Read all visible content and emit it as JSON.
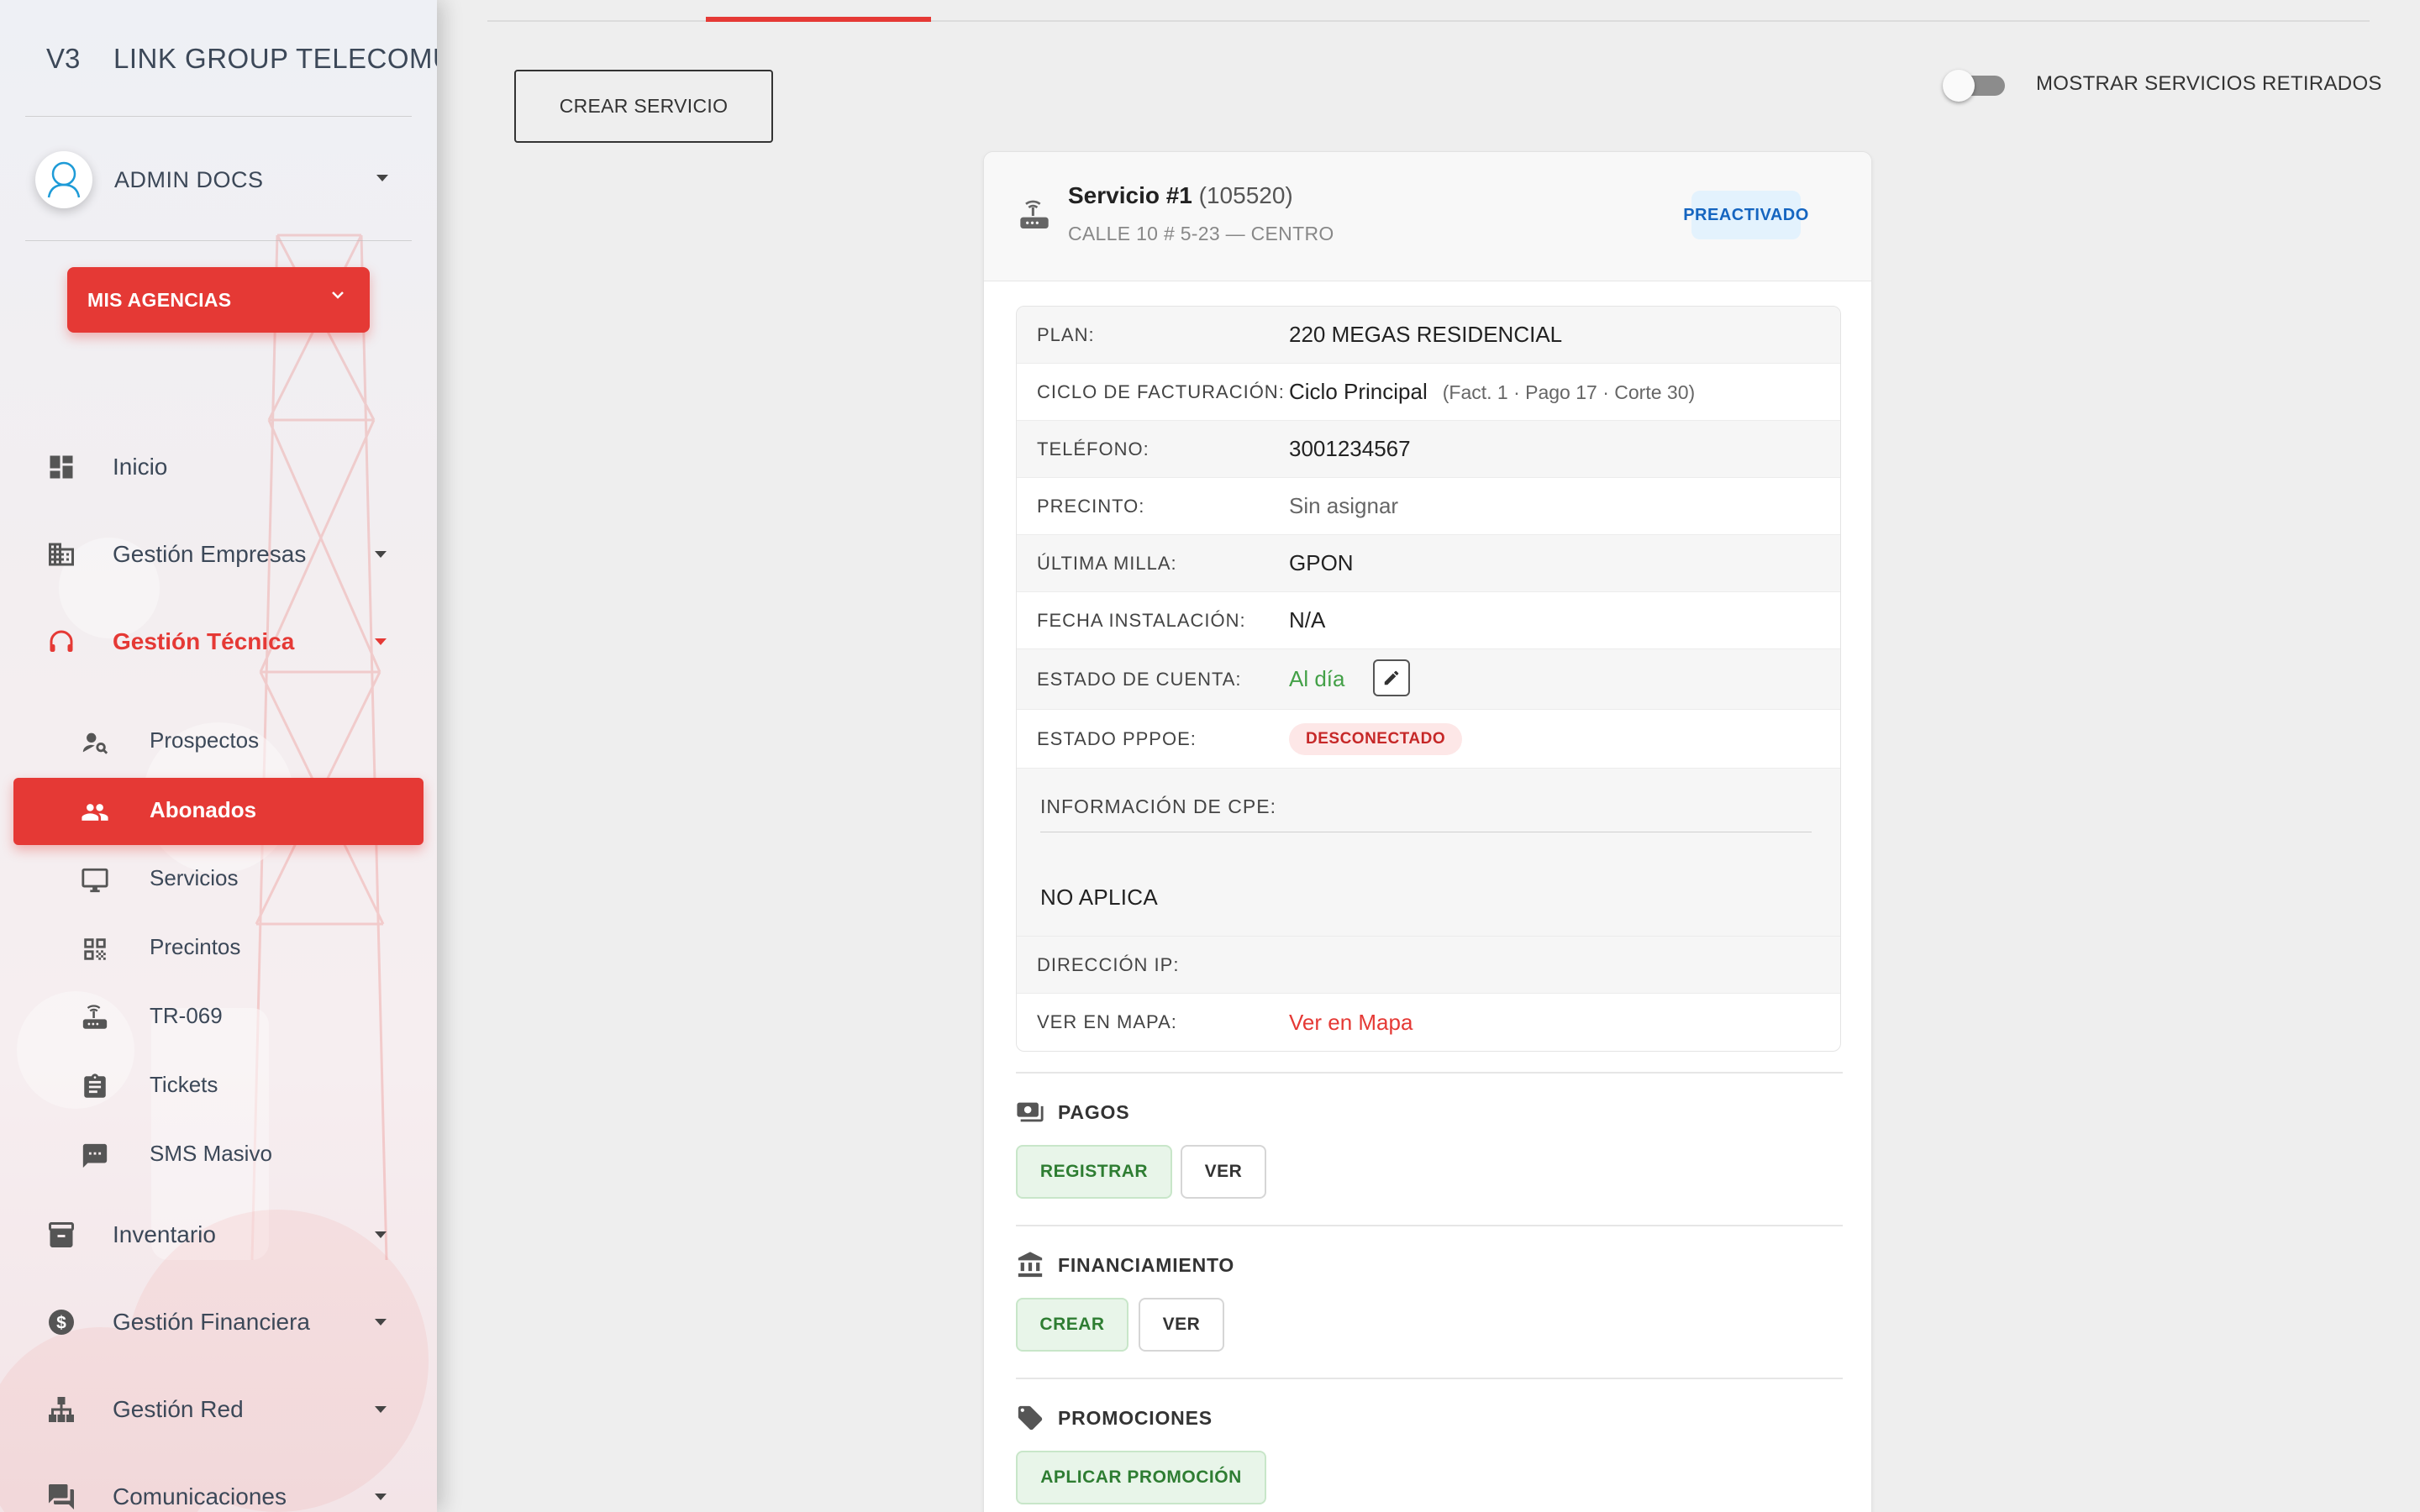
{
  "brand": {
    "mini": "V3",
    "name": "LINK GROUP TELECOMUNICACIONES"
  },
  "user": {
    "name": "ADMIN DOCS"
  },
  "agencias": {
    "label": "MIS AGENCIAS"
  },
  "nav": {
    "inicio": "Inicio",
    "empresas": "Gestión Empresas",
    "tecnica": "Gestión Técnica",
    "inventario": "Inventario",
    "financiera": "Gestión Financiera",
    "red": "Gestión Red",
    "comunicaciones": "Comunicaciones"
  },
  "subnav": {
    "prospectos": "Prospectos",
    "abonados": "Abonados",
    "servicios": "Servicios",
    "precintos": "Precintos",
    "tr069": "TR-069",
    "tickets": "Tickets",
    "sms": "SMS Masivo"
  },
  "toolbar": {
    "crear_servicio": "CREAR SERVICIO",
    "toggle_label": "MOSTRAR SERVICIOS RETIRADOS",
    "toggle_on": false
  },
  "service": {
    "title": "Servicio #1",
    "id": "(105520)",
    "address": "CALLE 10 # 5-23 — CENTRO",
    "status_badge": "PREACTIVADO",
    "fields": {
      "plan_label": "PLAN:",
      "plan_value": "220 MEGAS RESIDENCIAL",
      "ciclo_label": "CICLO DE FACTURACIÓN:",
      "ciclo_value": "Ciclo Principal",
      "ciclo_extra": "(Fact. 1 · Pago 17 · Corte 30)",
      "telefono_label": "TELÉFONO:",
      "telefono_value": "3001234567",
      "precinto_label": "PRECINTO:",
      "precinto_value": "Sin asignar",
      "milla_label": "ÚLTIMA MILLA:",
      "milla_value": "GPON",
      "fecha_label": "FECHA INSTALACIÓN:",
      "fecha_value": "N/A",
      "estado_cuenta_label": "ESTADO DE CUENTA:",
      "estado_cuenta_value": "Al día",
      "pppoe_label": "ESTADO PPPOE:",
      "pppoe_value": "DESCONECTADO",
      "cpe_label": "INFORMACIÓN DE CPE:",
      "cpe_value": "NO APLICA",
      "ip_label": "DIRECCIÓN IP:",
      "ip_value": "",
      "mapa_label": "VER EN MAPA:",
      "mapa_value": "Ver en Mapa"
    }
  },
  "sections": {
    "pagos": {
      "title": "PAGOS",
      "primary": "REGISTRAR",
      "secondary": "VER"
    },
    "financiamiento": {
      "title": "FINANCIAMIENTO",
      "primary": "CREAR",
      "secondary": "VER"
    },
    "promociones": {
      "title": "PROMOCIONES",
      "primary": "APLICAR PROMOCIÓN"
    }
  },
  "colors": {
    "accent": "#e53935",
    "success": "#43a047",
    "info_badge": "#1565c0"
  },
  "icons": {
    "inicio": "dashboard-icon",
    "empresas": "building-icon",
    "tecnica": "headset-icon",
    "inventario": "archive-icon",
    "financiera": "dollar-icon",
    "red": "network-icon",
    "comunicaciones": "chat-icon"
  }
}
